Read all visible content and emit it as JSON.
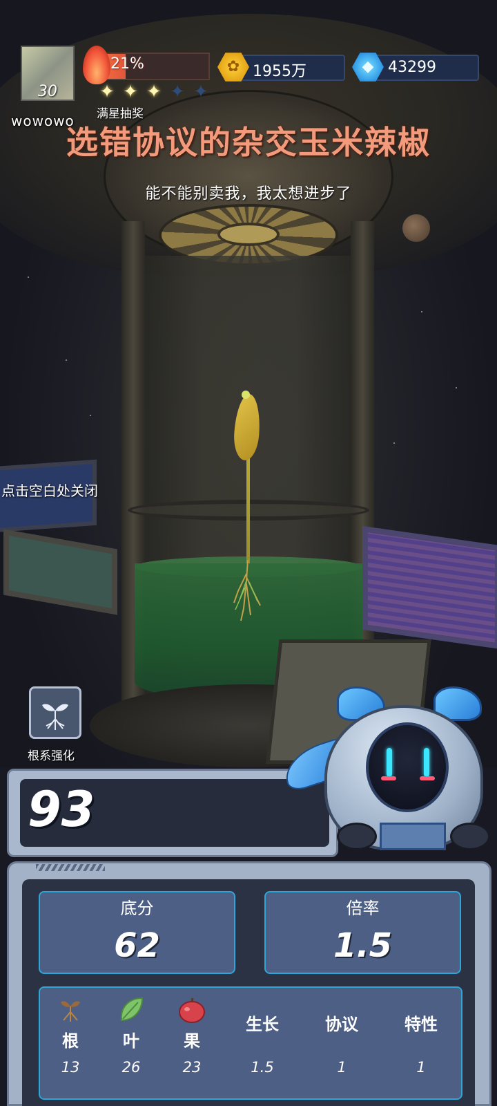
{
  "hud": {
    "player_level": "30",
    "username": "wowowo",
    "flame_percent_text": "21%",
    "flame_progress": 0.21,
    "stars_total": 5,
    "stars_filled": 3,
    "lottery_label": "满星抽奖",
    "coins": "1955万",
    "gems": "43299",
    "coin_icon": "sprout-coin-icon",
    "gem_icon": "blue-crystal-icon"
  },
  "plant": {
    "title": "选错协议的杂交玉米辣椒",
    "subtitle": "能不能别卖我，我太想进步了"
  },
  "hints": {
    "close_hint": "点击空白处关闭"
  },
  "root_boost": {
    "label": "根系强化",
    "icon": "sprout-roots-icon"
  },
  "score": {
    "total": "93",
    "base_label": "底分",
    "base_value": "62",
    "multiplier_label": "倍率",
    "multiplier_value": "1.5"
  },
  "attributes": [
    {
      "key": "root",
      "label": "根",
      "icon": "root-sprout-icon",
      "value": "13"
    },
    {
      "key": "leaf",
      "label": "叶",
      "icon": "leaf-icon",
      "value": "26"
    },
    {
      "key": "fruit",
      "label": "果",
      "icon": "apple-icon",
      "value": "23"
    },
    {
      "key": "growth",
      "label": "生长",
      "icon": "",
      "value": "1.5"
    },
    {
      "key": "protocol",
      "label": "协议",
      "icon": "",
      "value": "1"
    },
    {
      "key": "trait",
      "label": "特性",
      "icon": "",
      "value": "1"
    }
  ],
  "colors": {
    "title": "#f39a7c",
    "flame": "#e0573a",
    "stat_border": "#2fa6d8",
    "robot_eye": "#3ce6ff"
  }
}
